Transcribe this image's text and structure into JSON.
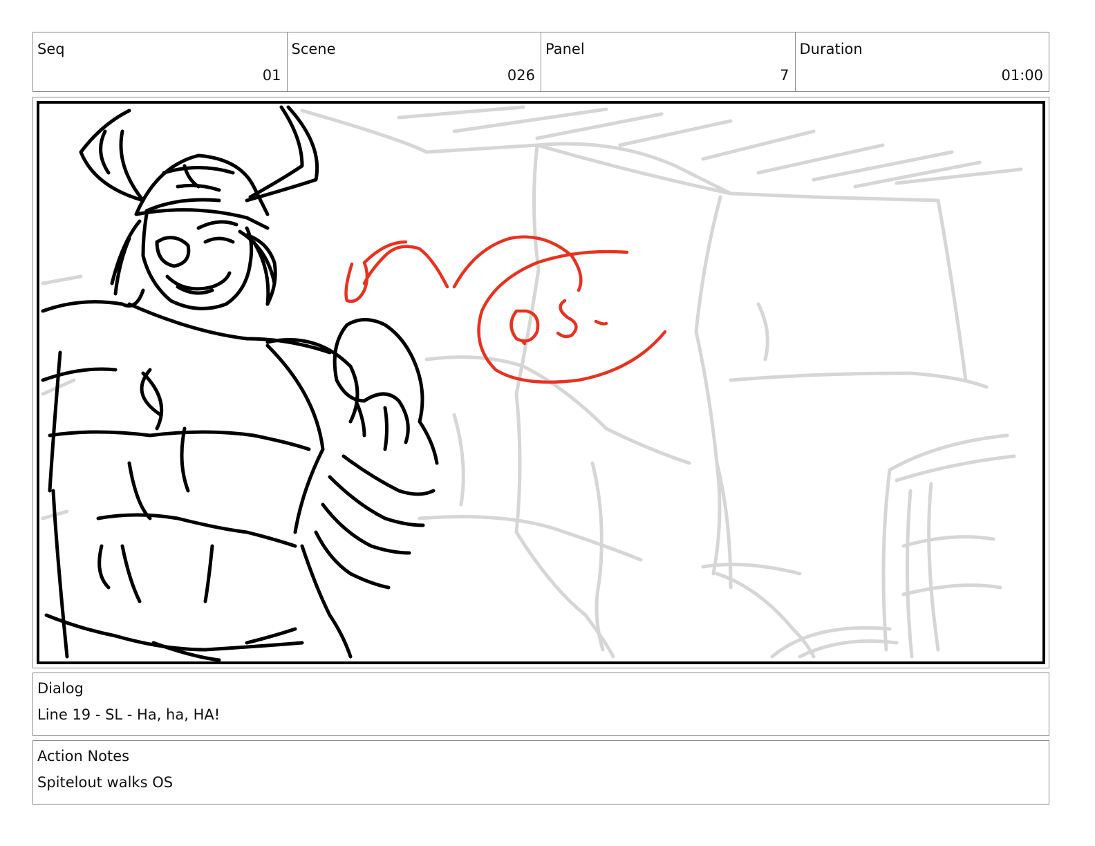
{
  "header": {
    "seq": {
      "label": "Seq",
      "value": "01"
    },
    "scene": {
      "label": "Scene",
      "value": "026"
    },
    "panel": {
      "label": "Panel",
      "value": "7"
    },
    "duration": {
      "label": "Duration",
      "value": "01:00"
    }
  },
  "panel_image": {
    "annotation_text": "O.S.",
    "colors": {
      "ink": "#000000",
      "background_sketch": "#d6d6d6",
      "annotation": "#e8321e"
    }
  },
  "dialog": {
    "label": "Dialog",
    "text": "Line 19 - SL - Ha, ha, HA!"
  },
  "action_notes": {
    "label": "Action Notes",
    "text": "Spitelout walks OS"
  }
}
